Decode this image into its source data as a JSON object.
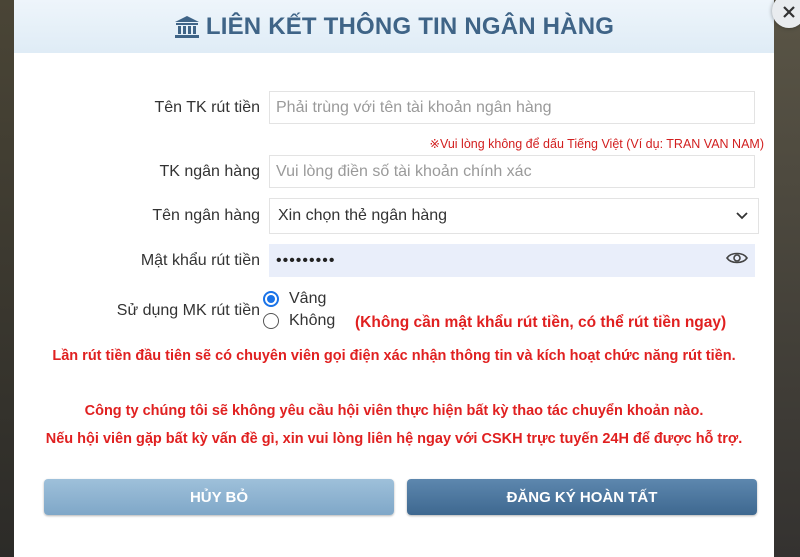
{
  "header": {
    "title": "LIÊN KẾT THÔNG TIN NGÂN HÀNG"
  },
  "form": {
    "account_name": {
      "label": "Tên TK rút tiền",
      "placeholder": "Phải trùng với tên tài khoản ngân hàng",
      "note": "※Vui lòng không để dấu Tiếng Việt (Ví dụ: TRAN VAN NAM)"
    },
    "account_number": {
      "label": "TK ngân hàng",
      "placeholder": "Vui lòng điền số tài khoản chính xác"
    },
    "bank_name": {
      "label": "Tên ngân hàng",
      "selected": "Xin chọn thẻ ngân hàng"
    },
    "withdraw_password": {
      "label": "Mật khẩu rút tiền",
      "value": "•••••••••"
    },
    "use_password": {
      "label": "Sử dụng MK rút tiền",
      "options": [
        {
          "label": "Vâng",
          "checked": true
        },
        {
          "label": "Không",
          "checked": false
        }
      ],
      "note": "(Không cần mật khẩu rút tiền, có thể rút tiền ngay)"
    }
  },
  "messages": {
    "line1": "Lần rút tiền đầu tiên sẽ có chuyên viên gọi điện xác nhận thông tin và kích hoạt chức năng rút tiền.",
    "line2": "Công ty chúng tôi sẽ không yêu cầu hội viên thực hiện bất kỳ thao tác chuyển khoản nào.",
    "line3": "Nếu hội viên gặp bất kỳ vấn đề gì, xin vui lòng liên hệ ngay với CSKH trực tuyến 24H để được hỗ trợ."
  },
  "buttons": {
    "cancel": "HỦY BỎ",
    "submit": "ĐĂNG KÝ HOÀN TẤT"
  },
  "icons": {
    "header": "bank-icon",
    "close": "close-icon",
    "dropdown": "chevron-down-icon",
    "password": "eye-icon"
  },
  "colors": {
    "header_text": "#3f6487",
    "warning_red": "#e02020",
    "cancel_button": "#8fb3d1",
    "submit_button": "#4d77a0",
    "radio_active": "#1a73e8"
  }
}
